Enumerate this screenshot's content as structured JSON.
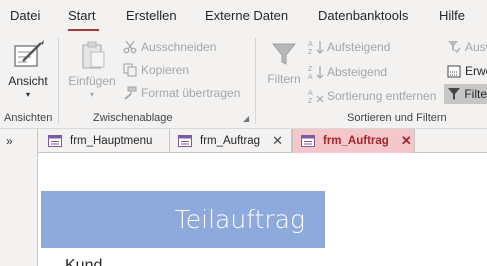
{
  "ribbon_tabs": {
    "datei": "Datei",
    "start": "Start",
    "erstellen": "Erstellen",
    "externe_daten": "Externe Daten",
    "datenbanktools": "Datenbanktools",
    "hilfe": "Hilfe"
  },
  "ansichten": {
    "ansicht_label": "Ansicht",
    "group_label": "Ansichten"
  },
  "zwischenablage": {
    "einfuegen_label": "Einfügen",
    "ausschneiden_label": "Ausschneiden",
    "kopieren_label": "Kopieren",
    "format_label": "Format übertragen",
    "group_label": "Zwischenablage"
  },
  "sortieren": {
    "filtern_label": "Filtern",
    "aufsteigend_label": "Aufsteigend",
    "absteigend_label": "Absteigend",
    "sortierung_label": "Sortierung entfernen",
    "ausw_label": "Ausw",
    "erwe_label": "Erwe",
    "filte_label": "Filte",
    "group_label": "Sortieren und Filtern"
  },
  "doc_tabs": [
    {
      "label": "frm_Hauptmenu"
    },
    {
      "label": "frm_Auftrag"
    },
    {
      "label": "frm_Auftrag"
    }
  ],
  "form": {
    "title": "Teilauftrag",
    "field_label": "Kund"
  },
  "colors": {
    "accent": "#a4373a",
    "title_band": "#8ea9db",
    "active_tab": "#f4c7cb"
  }
}
